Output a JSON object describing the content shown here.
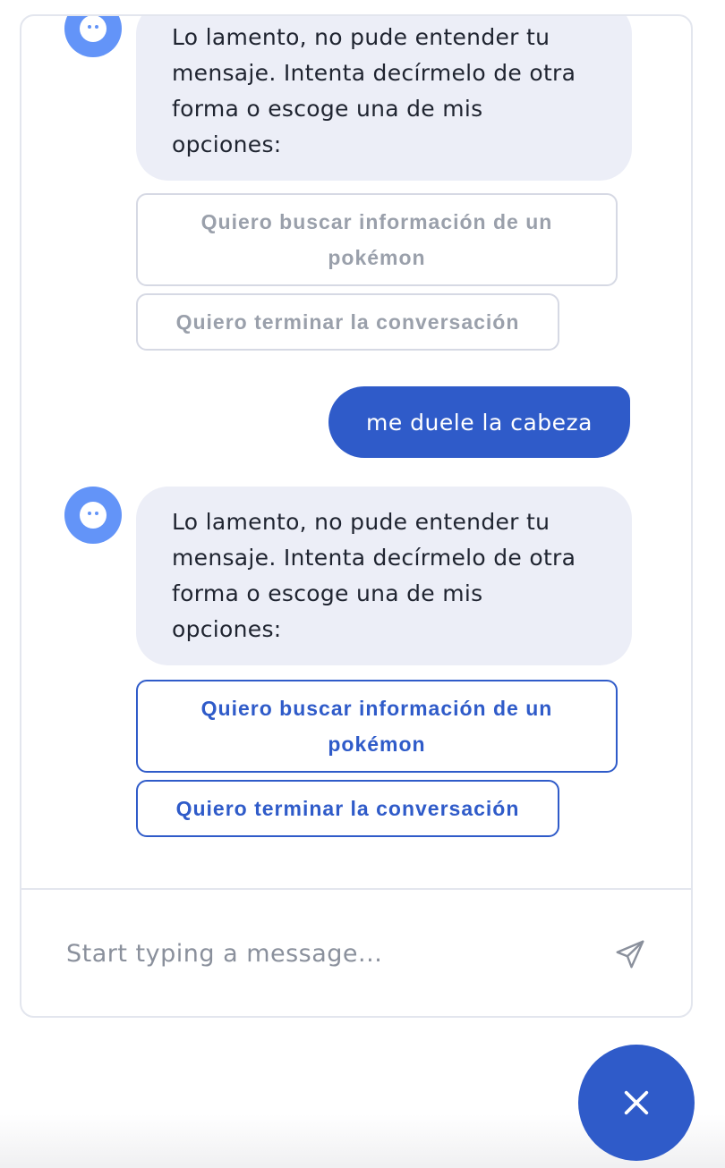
{
  "conversation": {
    "bot_message_1": "Lo lamento, no pude entender tu mensaje. Intenta decírmelo de otra forma o escoge una de mis opciones:",
    "options_1": [
      "Quiero buscar información de un pokémon",
      "Quiero terminar la conversación"
    ],
    "user_message": "me duele la cabeza",
    "bot_message_2": "Lo lamento, no pude entender tu mensaje. Intenta decírmelo de otra forma o escoge una de mis opciones:",
    "options_2": [
      "Quiero buscar información de un pokémon",
      "Quiero terminar la conversación"
    ]
  },
  "composer": {
    "placeholder": "Start typing a message..."
  },
  "icons": {
    "bot_avatar": "robot-face-icon",
    "send": "paper-plane-icon",
    "close": "close-icon"
  },
  "colors": {
    "accent": "#2f5bc9",
    "avatar": "#6394f8",
    "bot_bubble": "#eceef7",
    "disabled_text": "#9aa0ab"
  }
}
